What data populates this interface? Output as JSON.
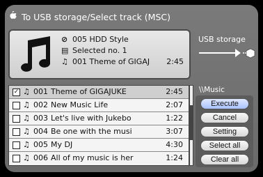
{
  "window": {
    "title": "To USB storage/Select track (MSC)",
    "title_icon": "apple-icon"
  },
  "info": {
    "album_line": "005  HDD Style",
    "selected_line": "Selected no. 1",
    "track_line": "001  Theme of GIGAJ",
    "duration": "2:45"
  },
  "destination": {
    "label": "USB storage"
  },
  "folder": {
    "path": "\\\\Music"
  },
  "tracks": [
    {
      "checked": "✓",
      "num": "001",
      "title": "Theme of GIGAJUKE",
      "time": "2:45"
    },
    {
      "checked": "",
      "num": "002",
      "title": "New Music Life",
      "time": "2:07"
    },
    {
      "checked": "",
      "num": "003",
      "title": "Let's live with Jukebo",
      "time": "1:22"
    },
    {
      "checked": "",
      "num": "004",
      "title": "Be one with the musi",
      "time": "3:07"
    },
    {
      "checked": "",
      "num": "005",
      "title": "My DJ",
      "time": "4:30"
    },
    {
      "checked": "",
      "num": "006",
      "title": "All of my music is her",
      "time": "1:24"
    }
  ],
  "buttons": {
    "execute": "Execute",
    "cancel": "Cancel",
    "setting": "Setting",
    "select_all": "Select all",
    "clear_all": "Clear all"
  },
  "colors": {
    "background": "#6f6f6f",
    "list_bg": "#f4f4f4",
    "active_button": "#b8ccff"
  }
}
